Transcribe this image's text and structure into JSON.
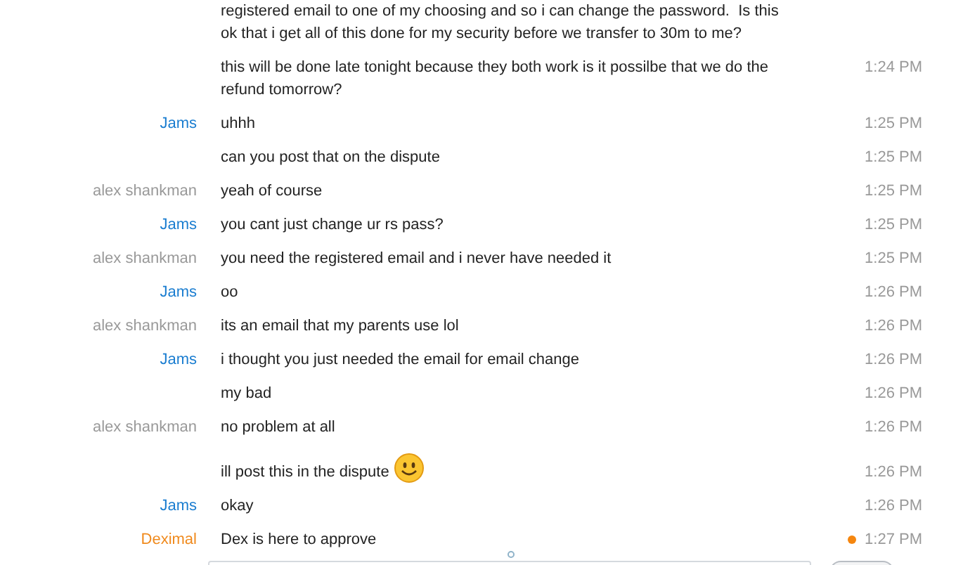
{
  "messages": [
    {
      "text": "registered email to one of my choosing and so i can change the password.  Is this ok that i get all of this done for my security before we transfer to 30m to me?",
      "smiley": false,
      "unread": false
    },
    {
      "text": "this will be done late tonight because they both work is it possilbe that we do the refund tomorrow?",
      "time": "1:24 PM",
      "smiley": false,
      "unread": false
    },
    {
      "sender": "Jams",
      "color": "#1a7dd0",
      "text": "uhhh",
      "time": "1:25 PM",
      "smiley": false,
      "unread": false
    },
    {
      "text": "can you post that on the dispute",
      "time": "1:25 PM",
      "smiley": false,
      "unread": false
    },
    {
      "sender": "alex shankman",
      "color": "#999999",
      "text": "yeah of course",
      "time": "1:25 PM",
      "smiley": false,
      "unread": false
    },
    {
      "sender": "Jams",
      "color": "#1a7dd0",
      "text": "you cant just change ur rs pass?",
      "time": "1:25 PM",
      "smiley": false,
      "unread": false
    },
    {
      "sender": "alex shankman",
      "color": "#999999",
      "text": "you need the registered email and i never have needed it",
      "time": "1:25 PM",
      "smiley": false,
      "unread": false
    },
    {
      "sender": "Jams",
      "color": "#1a7dd0",
      "text": "oo",
      "time": "1:26 PM",
      "smiley": false,
      "unread": false
    },
    {
      "sender": "alex shankman",
      "color": "#999999",
      "text": "its an email that my parents use lol",
      "time": "1:26 PM",
      "smiley": false,
      "unread": false
    },
    {
      "sender": "Jams",
      "color": "#1a7dd0",
      "text": "i thought you just needed the email for email change",
      "time": "1:26 PM",
      "smiley": false,
      "unread": false
    },
    {
      "text": "my bad",
      "time": "1:26 PM",
      "smiley": false,
      "unread": false
    },
    {
      "sender": "alex shankman",
      "color": "#999999",
      "text": "no problem at all",
      "time": "1:26 PM",
      "smiley": false,
      "unread": false
    },
    {
      "text": "ill post this in the dispute",
      "time": "1:26 PM",
      "smiley": true,
      "unread": false
    },
    {
      "sender": "Jams",
      "color": "#1a7dd0",
      "text": "okay",
      "time": "1:26 PM",
      "smiley": false,
      "unread": false
    },
    {
      "sender": "Deximal",
      "color": "#f08a1d",
      "text": "Dex is here to approve",
      "time": "1:27 PM",
      "smiley": false,
      "unread": true
    }
  ]
}
